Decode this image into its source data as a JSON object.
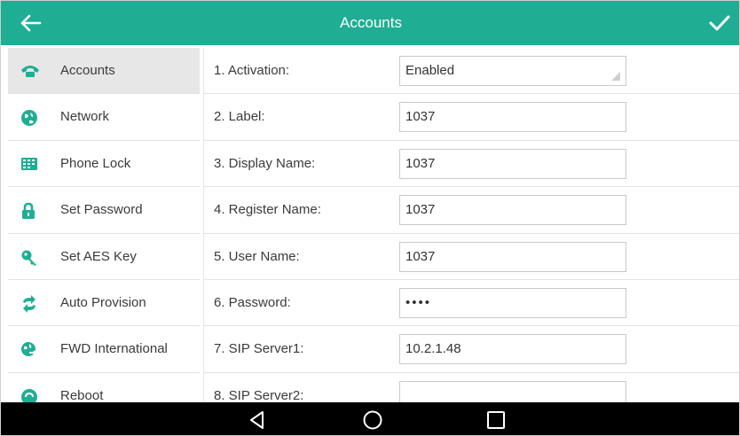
{
  "header": {
    "title": "Accounts",
    "back_icon": "arrow-left-icon",
    "confirm_icon": "checkmark-icon"
  },
  "colors": {
    "header_bg": "#1fae93",
    "navbar_bg": "#000000",
    "active_item_bg": "#e7e7e7"
  },
  "sidebar": {
    "items": [
      {
        "label": "Accounts",
        "icon": "phone-icon",
        "active": true
      },
      {
        "label": "Network",
        "icon": "globe-icon",
        "active": false
      },
      {
        "label": "Phone Lock",
        "icon": "keypad-icon",
        "active": false
      },
      {
        "label": "Set Password",
        "icon": "lock-icon",
        "active": false
      },
      {
        "label": "Set AES Key",
        "icon": "key-icon",
        "active": false
      },
      {
        "label": "Auto Provision",
        "icon": "sync-arrows-icon",
        "active": false
      },
      {
        "label": "FWD International",
        "icon": "globe-forward-icon",
        "active": false
      },
      {
        "label": "Reboot",
        "icon": "reboot-icon",
        "active": false
      }
    ]
  },
  "fields": [
    {
      "label": "1. Activation:",
      "value": "Enabled",
      "type": "select"
    },
    {
      "label": "2. Label:",
      "value": "1037",
      "type": "text"
    },
    {
      "label": "3. Display Name:",
      "value": "1037",
      "type": "text"
    },
    {
      "label": "4. Register Name:",
      "value": "1037",
      "type": "text"
    },
    {
      "label": "5. User Name:",
      "value": "1037",
      "type": "text"
    },
    {
      "label": "6. Password:",
      "value": "••••",
      "type": "password"
    },
    {
      "label": "7. SIP Server1:",
      "value": "10.2.1.48",
      "type": "text"
    },
    {
      "label": "8. SIP Server2:",
      "value": "",
      "type": "text"
    }
  ],
  "navbar": {
    "buttons": [
      "back-triangle-icon",
      "home-circle-icon",
      "recents-square-icon"
    ]
  }
}
